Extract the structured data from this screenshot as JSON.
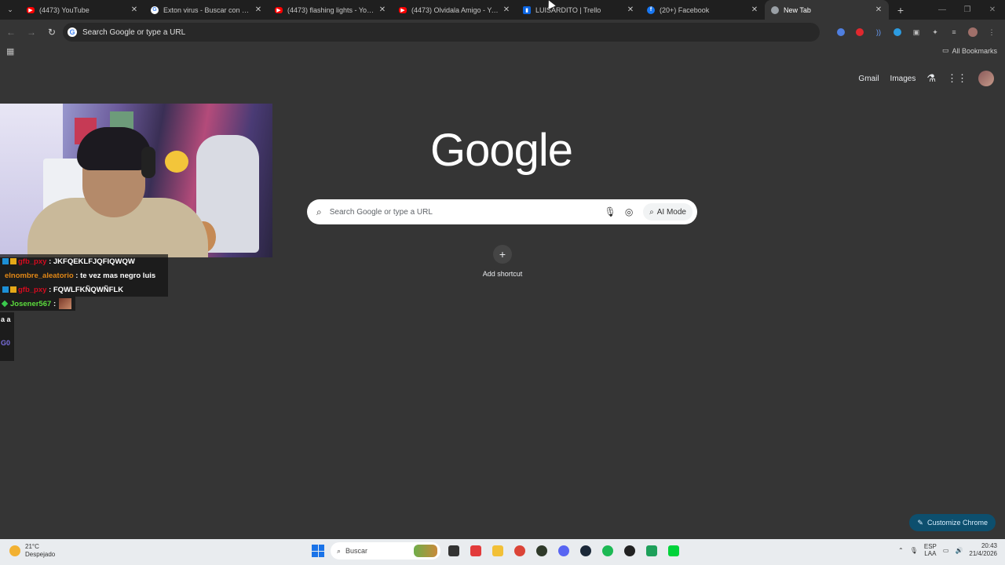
{
  "tabs": [
    {
      "title": "(4473) YouTube",
      "favicon": "youtube-icon",
      "active": false
    },
    {
      "title": "Exton virus - Buscar con Google",
      "favicon": "google-icon",
      "active": false
    },
    {
      "title": "(4473) flashing lights - YouTube",
      "favicon": "youtube-icon",
      "active": false
    },
    {
      "title": "(4473) Olvidala Amigo - YouTube",
      "favicon": "youtube-icon",
      "active": false
    },
    {
      "title": "LUISARDITO | Trello",
      "favicon": "trello-icon",
      "active": false
    },
    {
      "title": "(20+) Facebook",
      "favicon": "facebook-icon",
      "active": false
    },
    {
      "title": "New Tab",
      "favicon": "chrome-icon",
      "active": true
    }
  ],
  "toolbar": {
    "omnibox_text": "Search Google or type a URL"
  },
  "bookmarks": {
    "all_bookmarks": "All Bookmarks"
  },
  "ntp": {
    "gmail": "Gmail",
    "images": "Images",
    "logo": "Google",
    "search_placeholder": "Search Google or type a URL",
    "ai_mode": "AI Mode",
    "add_shortcut": "Add shortcut",
    "customize": "Customize Chrome"
  },
  "chat": {
    "lines": [
      {
        "user": "gfb_pxy",
        "message": ": JKFQEKLFJQFIQWQW"
      },
      {
        "user": "elnombre_aleatorio",
        "message": ": te vez mas negro luis"
      },
      {
        "user": "gfb_pxy",
        "message": ": FQWLFKÑQWÑFLK"
      },
      {
        "user": "Josener567",
        "message": ":"
      }
    ],
    "extra_1": "a a",
    "extra_2": "G0"
  },
  "taskbar": {
    "temperature": "21°C",
    "weather": "Despejado",
    "search": "Buscar",
    "lang_1": "ESP",
    "lang_2": "LAA",
    "time": "20:43",
    "date": "21/4/2026"
  },
  "colors": {
    "accent": "#1a73e8",
    "background": "#353535",
    "customize_bg": "#0d4f6e"
  }
}
